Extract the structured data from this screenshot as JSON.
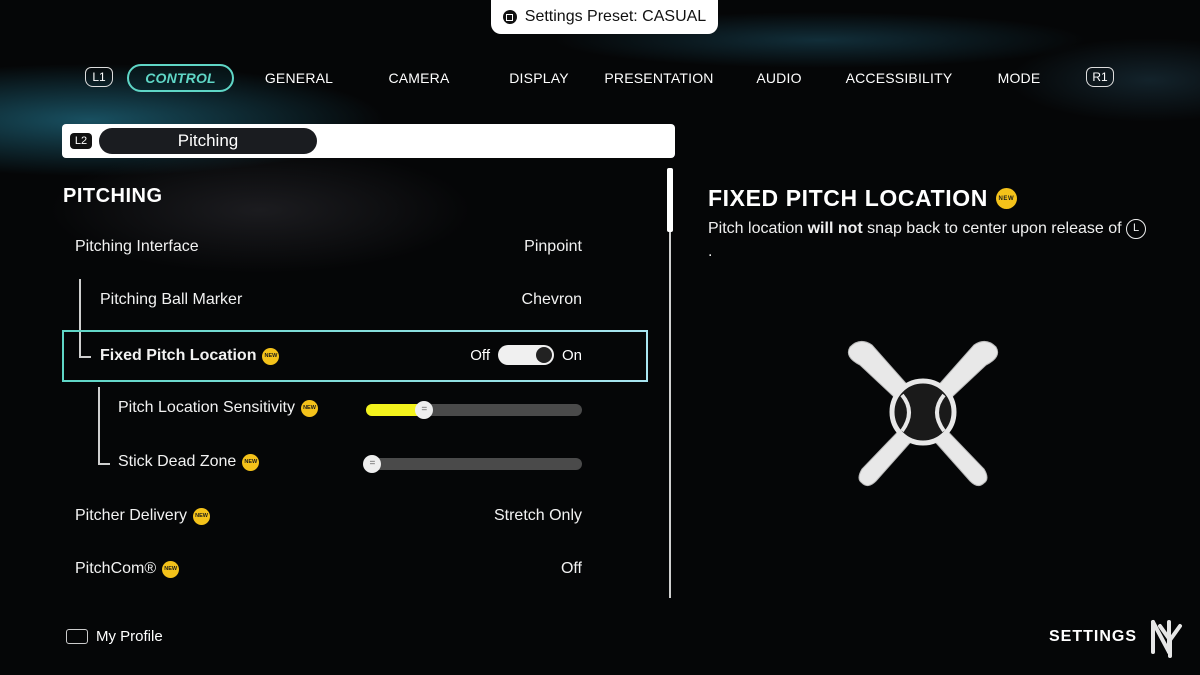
{
  "preset": {
    "text": "Settings Preset: CASUAL"
  },
  "nav": {
    "left_button": "L1",
    "right_button": "R1",
    "tabs": [
      {
        "label": "CONTROL",
        "active": true
      },
      {
        "label": "GENERAL"
      },
      {
        "label": "CAMERA"
      },
      {
        "label": "DISPLAY"
      },
      {
        "label": "PRESENTATION"
      },
      {
        "label": "AUDIO"
      },
      {
        "label": "ACCESSIBILITY"
      },
      {
        "label": "MODE"
      }
    ]
  },
  "subnav": {
    "button": "L2",
    "label": "Pitching"
  },
  "section": {
    "title": "PITCHING"
  },
  "settings": [
    {
      "label": "Pitching Interface",
      "value": "Pinpoint"
    },
    {
      "label": "Pitching Ball Marker",
      "value": "Chevron"
    },
    {
      "label": "Fixed Pitch Location",
      "new": "NEW",
      "toggle_off": "Off",
      "toggle_on": "On",
      "state": "On"
    },
    {
      "label": "Pitch Location Sensitivity",
      "new": "NEW",
      "slider_fraction": 0.27
    },
    {
      "label": "Stick Dead Zone",
      "new": "NEW",
      "slider_fraction": 0.03
    },
    {
      "label": "Pitcher Delivery",
      "new": "NEW",
      "value": "Stretch Only"
    },
    {
      "label": "PitchCom®",
      "new": "NEW",
      "value": "Off"
    }
  ],
  "info": {
    "title": "FIXED PITCH LOCATION",
    "new": "NEW",
    "desc_part1": "Pitch location ",
    "desc_bold": "will not",
    "desc_part2": " snap back to center upon release of ",
    "desc_button": "L",
    "desc_end": "."
  },
  "footer": {
    "profile": "My Profile",
    "settings": "SETTINGS"
  },
  "colors": {
    "accent": "#5fd6c6",
    "slider_fill": "#f3f21c",
    "new_badge": "#f4c21a"
  }
}
